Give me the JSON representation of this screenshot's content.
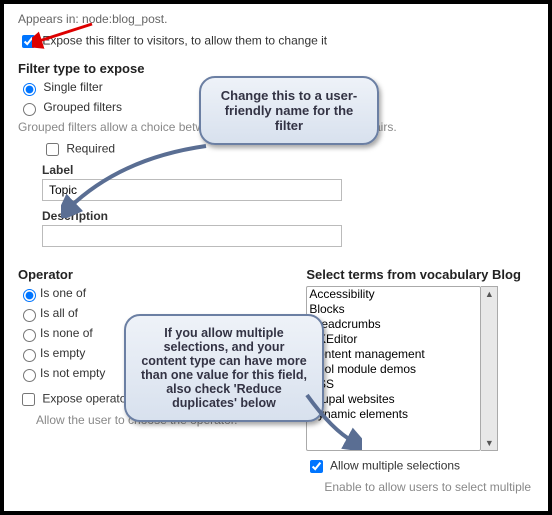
{
  "appears_in": "Appears in: node:blog_post.",
  "expose_label": "Expose this filter to visitors, to allow them to change it",
  "filter_type_title": "Filter type to expose",
  "filter_type": {
    "single": "Single filter",
    "grouped": "Grouped filters"
  },
  "grouped_hint": "Grouped filters allow a choice between predefined operator|value pairs.",
  "required_label": "Required",
  "label_label": "Label",
  "label_value": "Topic",
  "description_label": "Description",
  "description_value": "",
  "operator_title": "Operator",
  "operators": {
    "one_of": "Is one of",
    "all_of": "Is all of",
    "none_of": "Is none of",
    "empty": "Is empty",
    "not_empty": "Is not empty"
  },
  "expose_operator_label": "Expose operator",
  "expose_operator_hint": "Allow the user to choose the operator.",
  "vocab_title": "Select terms from vocabulary Blog",
  "vocab_terms": [
    "Accessibility",
    "Blocks",
    "Breadcrumbs",
    "CKEditor",
    "Content management",
    "Cool module demos",
    "CSS",
    "Drupal websites",
    "Dynamic elements"
  ],
  "allow_multiple_label": "Allow multiple selections",
  "allow_multiple_hint": "Enable to allow users to select multiple",
  "callout1_text": "Change this to a user-friendly name for the filter",
  "callout2_text": "If you allow multiple selections, and your content type can have more than one value for this field, also check 'Reduce duplicates' below"
}
